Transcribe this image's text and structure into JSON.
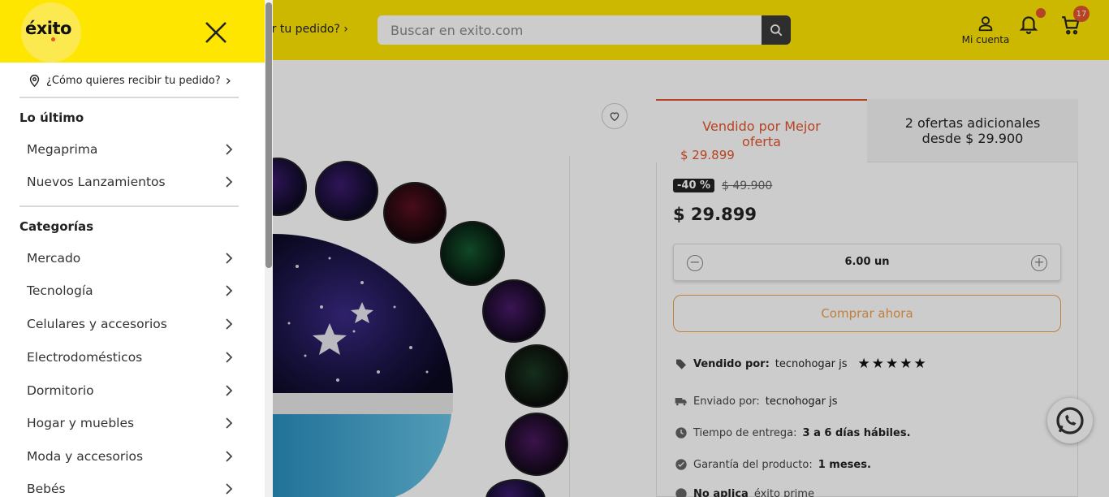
{
  "header": {
    "delivery_prompt": "¿Cómo quieres recibir tu pedido?",
    "delivery_partial": "ibir tu pedido?",
    "search_placeholder": "Buscar en exito.com",
    "account_label": "Mi cuenta",
    "cart_count": "17",
    "brand_color": "#ffe600",
    "accent_color": "#e4542c"
  },
  "menu": {
    "logo": "éxito",
    "close_icon": "close-icon",
    "delivery_prompt": "¿Cómo quieres recibir tu pedido?",
    "sections": [
      {
        "title": "Lo último",
        "items": [
          "Megaprima",
          "Nuevos Lanzamientos"
        ]
      },
      {
        "title": "Categorías",
        "items": [
          "Mercado",
          "Tecnología",
          "Celulares y accesorios",
          "Electrodomésticos",
          "Dormitorio",
          "Hogar y muebles",
          "Moda y accesorios",
          "Bebés"
        ]
      }
    ]
  },
  "product": {
    "tab_seller_title": "Vendido por Mejor oferta",
    "tab_seller_price": "$ 29.899",
    "tab_offers_title": "2 ofertas adicionales desde $ 29.900",
    "discount": "-40 %",
    "old_price": "$ 49.900",
    "price": "$ 29.899",
    "quantity": "6.00 un",
    "buy_label": "Comprar ahora",
    "sold_by_label": "Vendido por:",
    "sold_by_value": "tecnohogar js",
    "rating_stars": "★★★★★",
    "shipped_by_label": "Enviado por:",
    "shipped_by_value": "tecnohogar js",
    "delivery_time_label": "Tiempo de entrega:",
    "delivery_time_value": "3 a 6 días hábiles.",
    "warranty_label": "Garantía del producto:",
    "warranty_value": "1 meses.",
    "prime_label": "No aplica",
    "prime_value": "éxito prime"
  }
}
